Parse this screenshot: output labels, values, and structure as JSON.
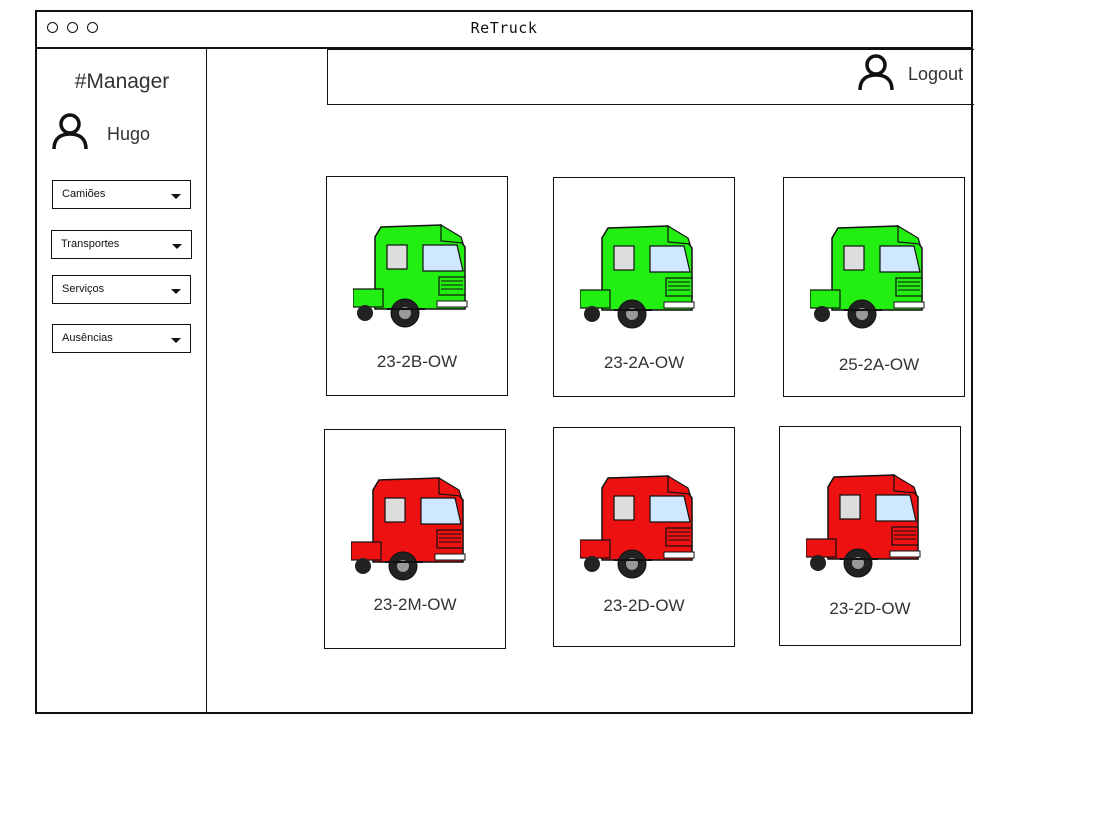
{
  "window": {
    "title": "ReTruck"
  },
  "sidebar": {
    "role": "#Manager",
    "user_name": "Hugo",
    "menus": [
      {
        "label": "Camiões"
      },
      {
        "label": "Transportes"
      },
      {
        "label": "Serviços"
      },
      {
        "label": "Ausências"
      }
    ]
  },
  "header": {
    "logout_label": "Logout"
  },
  "trucks": [
    {
      "plate": "23-2B-OW",
      "color": "#22ee11"
    },
    {
      "plate": "23-2A-OW",
      "color": "#22ee11"
    },
    {
      "plate": "25-2A-OW",
      "color": "#22ee11"
    },
    {
      "plate": "23-2M-OW",
      "color": "#ee1111"
    },
    {
      "plate": "23-2D-OW",
      "color": "#ee1111"
    },
    {
      "plate": "23-2D-OW",
      "color": "#ee1111"
    }
  ]
}
